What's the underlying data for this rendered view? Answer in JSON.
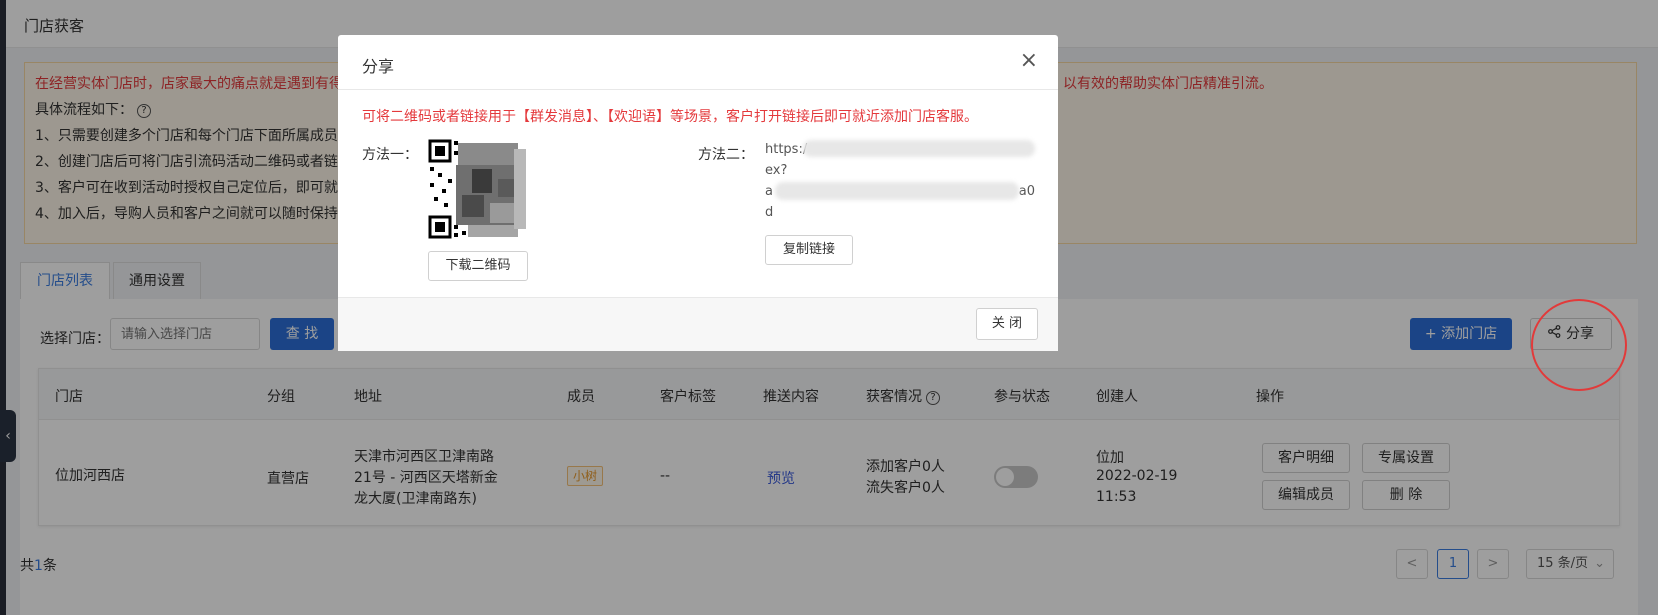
{
  "page": {
    "title": "门店获客"
  },
  "notice": {
    "line1_left": "在经营实体门店时，店家最大的痛点就是遇到有得",
    "line1_right": "以有效的帮助实体门店精准引流。",
    "line2": "具体流程如下：",
    "line3": "1、只需要创建多个门店和每个门店下面所属成员",
    "line4": "2、创建门店后可将门店引流码活动二维码或者链",
    "line5": "3、客户可在收到活动时授权自己定位后，即可就",
    "line6": "4、加入后，导购人员和客户之间就可以随时保持"
  },
  "tabs": [
    {
      "label": "门店列表",
      "active": true
    },
    {
      "label": "通用设置",
      "active": false
    }
  ],
  "filter": {
    "label": "选择门店：",
    "placeholder": "请输入选择门店",
    "search_button": "查 找"
  },
  "toolbar": {
    "add_store_button": "+ 添加门店",
    "share_button": "分享"
  },
  "table": {
    "headers": [
      "门店",
      "分组",
      "地址",
      "成员",
      "客户标签",
      "推送内容",
      "获客情况",
      "参与状态",
      "创建人",
      "操作"
    ],
    "rows": [
      {
        "store": "位加河西店",
        "group": "直营店",
        "address_line1": "天津市河西区卫津南路",
        "address_line2": "21号 - 河西区天塔新金",
        "address_line3": "龙大厦(卫津南路东)",
        "member_tag": "小树",
        "customer_tags": "--",
        "push_content": "预览",
        "acquired": "添加客户0人",
        "lost": "流失客户0人",
        "status_on": false,
        "creator": "位加",
        "created_date": "2022-02-19",
        "created_time": "11:53",
        "actions": [
          "客户明细",
          "专属设置",
          "编辑成员",
          "删 除"
        ]
      }
    ]
  },
  "pagination": {
    "total_prefix": "共",
    "total_count": "1",
    "total_suffix": "条",
    "prev": "<",
    "current_page": "1",
    "next": ">",
    "page_size": "15 条/页"
  },
  "modal": {
    "title": "分享",
    "close_icon": "×",
    "description": "可将二维码或者链接用于【群发消息】、【欢迎语】等场景，客户打开链接后即可就近添加门店客服。",
    "method1_label": "方法一：",
    "download_qr_button": "下载二维码",
    "method2_label": "方法二：",
    "link_line1": "https:/",
    "link_line1_tail": "",
    "link_line2": "ex?",
    "link_line3": "a",
    "link_line3_tail": "a0",
    "link_line4": "d",
    "copy_link_button": "复制链接",
    "footer_close_button": "关 闭"
  },
  "colors": {
    "primary": "#2c6ed8",
    "warning_text": "#e4393c",
    "highlight_circle": "#e23a3a",
    "notice_bg": "#fdf6e8"
  },
  "icons": {
    "share": "share-icon",
    "help": "help-circle-icon",
    "close": "close-icon",
    "collapse": "chevron-left-icon",
    "dropdown": "chevron-down-icon"
  }
}
